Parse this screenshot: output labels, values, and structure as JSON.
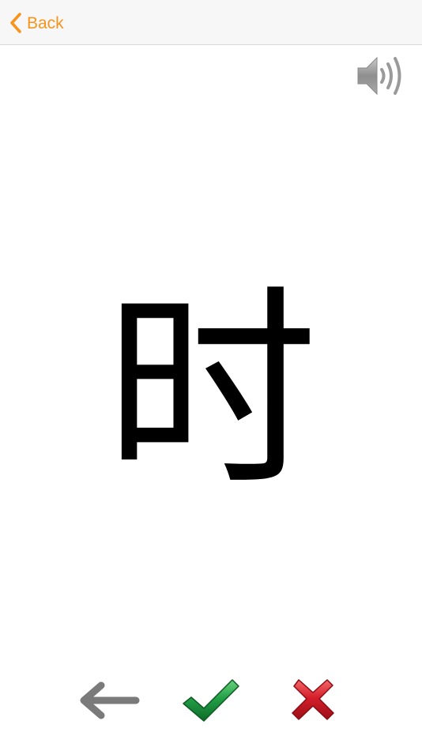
{
  "navbar": {
    "back_label": "Back",
    "accent_color": "#f7941d"
  },
  "audio": {
    "icon": "speaker-volume-icon"
  },
  "flashcard": {
    "character": "时"
  },
  "actions": {
    "previous_icon": "arrow-left-icon",
    "correct_icon": "checkmark-icon",
    "wrong_icon": "cross-icon",
    "previous_color": "#7a7a7a",
    "correct_color": "#1e8a3c",
    "wrong_color": "#d01e2a"
  }
}
